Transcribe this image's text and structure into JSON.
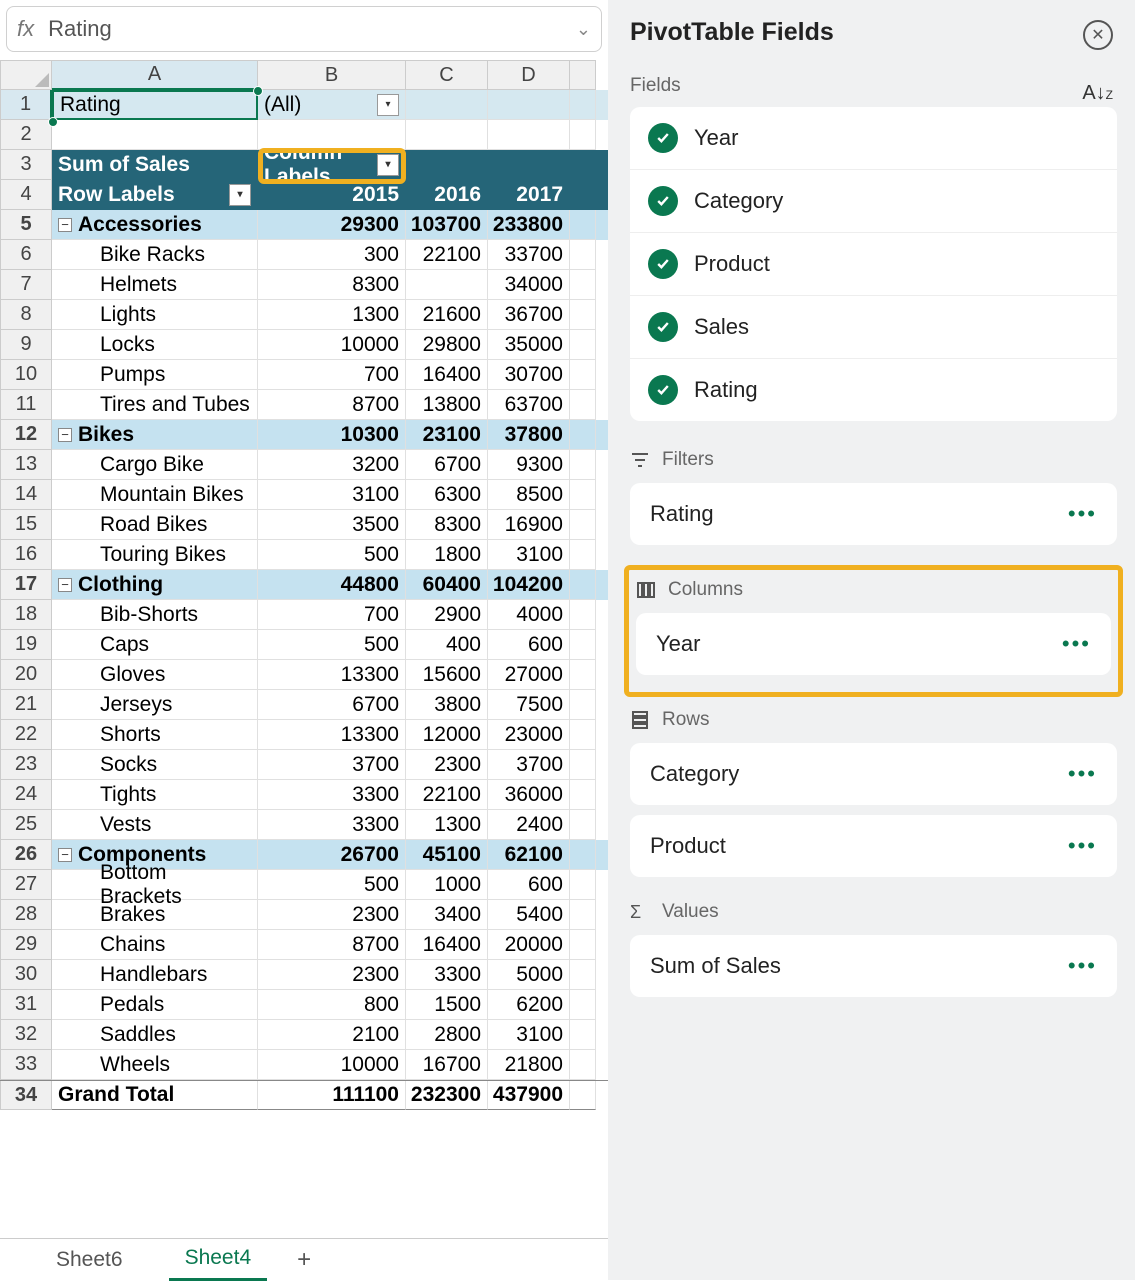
{
  "formula_bar": {
    "fx": "fx",
    "value": "Rating"
  },
  "columns": [
    "A",
    "B",
    "C",
    "D"
  ],
  "rows_numbers": {
    "start": 1,
    "end": 34
  },
  "pivot": {
    "filter_label": "Rating",
    "filter_value": "(All)",
    "sum_label": "Sum of Sales",
    "col_labels_label": "Column Labels",
    "row_labels_label": "Row Labels",
    "years": [
      "2015",
      "2016",
      "2017"
    ],
    "grand_total_label": "Grand Total",
    "grand_total": [
      "111100",
      "232300",
      "437900"
    ],
    "categories": [
      {
        "name": "Accessories",
        "totals": [
          "29300",
          "103700",
          "233800"
        ],
        "items": [
          {
            "name": "Bike Racks",
            "v": [
              "300",
              "22100",
              "33700"
            ]
          },
          {
            "name": "Helmets",
            "v": [
              "8300",
              "",
              "34000"
            ]
          },
          {
            "name": "Lights",
            "v": [
              "1300",
              "21600",
              "36700"
            ]
          },
          {
            "name": "Locks",
            "v": [
              "10000",
              "29800",
              "35000"
            ]
          },
          {
            "name": "Pumps",
            "v": [
              "700",
              "16400",
              "30700"
            ]
          },
          {
            "name": "Tires and Tubes",
            "v": [
              "8700",
              "13800",
              "63700"
            ]
          }
        ]
      },
      {
        "name": "Bikes",
        "totals": [
          "10300",
          "23100",
          "37800"
        ],
        "items": [
          {
            "name": "Cargo Bike",
            "v": [
              "3200",
              "6700",
              "9300"
            ]
          },
          {
            "name": "Mountain Bikes",
            "v": [
              "3100",
              "6300",
              "8500"
            ]
          },
          {
            "name": "Road Bikes",
            "v": [
              "3500",
              "8300",
              "16900"
            ]
          },
          {
            "name": "Touring Bikes",
            "v": [
              "500",
              "1800",
              "3100"
            ]
          }
        ]
      },
      {
        "name": "Clothing",
        "totals": [
          "44800",
          "60400",
          "104200"
        ],
        "items": [
          {
            "name": "Bib-Shorts",
            "v": [
              "700",
              "2900",
              "4000"
            ]
          },
          {
            "name": "Caps",
            "v": [
              "500",
              "400",
              "600"
            ]
          },
          {
            "name": "Gloves",
            "v": [
              "13300",
              "15600",
              "27000"
            ]
          },
          {
            "name": "Jerseys",
            "v": [
              "6700",
              "3800",
              "7500"
            ]
          },
          {
            "name": "Shorts",
            "v": [
              "13300",
              "12000",
              "23000"
            ]
          },
          {
            "name": "Socks",
            "v": [
              "3700",
              "2300",
              "3700"
            ]
          },
          {
            "name": "Tights",
            "v": [
              "3300",
              "22100",
              "36000"
            ]
          },
          {
            "name": "Vests",
            "v": [
              "3300",
              "1300",
              "2400"
            ]
          }
        ]
      },
      {
        "name": "Components",
        "totals": [
          "26700",
          "45100",
          "62100"
        ],
        "items": [
          {
            "name": "Bottom Brackets",
            "v": [
              "500",
              "1000",
              "600"
            ]
          },
          {
            "name": "Brakes",
            "v": [
              "2300",
              "3400",
              "5400"
            ]
          },
          {
            "name": "Chains",
            "v": [
              "8700",
              "16400",
              "20000"
            ]
          },
          {
            "name": "Handlebars",
            "v": [
              "2300",
              "3300",
              "5000"
            ]
          },
          {
            "name": "Pedals",
            "v": [
              "800",
              "1500",
              "6200"
            ]
          },
          {
            "name": "Saddles",
            "v": [
              "2100",
              "2800",
              "3100"
            ]
          },
          {
            "name": "Wheels",
            "v": [
              "10000",
              "16700",
              "21800"
            ]
          }
        ]
      }
    ]
  },
  "tabs": {
    "sheet6": "Sheet6",
    "sheet4": "Sheet4"
  },
  "panel": {
    "title": "PivotTable Fields",
    "fields_label": "Fields",
    "fields": [
      "Year",
      "Category",
      "Product",
      "Sales",
      "Rating"
    ],
    "zones": {
      "filters": {
        "label": "Filters",
        "items": [
          "Rating"
        ]
      },
      "columns": {
        "label": "Columns",
        "items": [
          "Year"
        ]
      },
      "rows": {
        "label": "Rows",
        "items": [
          "Category",
          "Product"
        ]
      },
      "values": {
        "label": "Values",
        "items": [
          "Sum of Sales"
        ]
      }
    }
  }
}
